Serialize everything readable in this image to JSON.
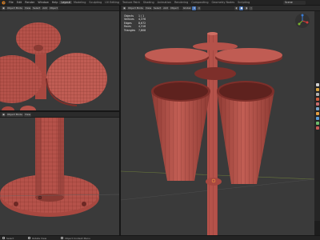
{
  "topbar": {
    "menus": [
      "File",
      "Edit",
      "Render",
      "Window",
      "Help"
    ],
    "workspaces": [
      "Layout",
      "Modeling",
      "Sculpting",
      "UV Editing",
      "Texture Paint",
      "Shading",
      "Animation",
      "Rendering",
      "Compositing",
      "Geometry Nodes",
      "Scripting"
    ],
    "active_workspace": "Layout",
    "scene": "Scene"
  },
  "viewports": {
    "top_left": {
      "mode": "Object Mode",
      "view": "View",
      "select": "Select",
      "add": "Add",
      "object": "Object"
    },
    "bottom_left": {
      "mode": "Object Mode",
      "view": "View"
    },
    "main": {
      "mode": "Object Mode",
      "view": "View",
      "select": "Select",
      "add": "Add",
      "object": "Object",
      "shading": "Global"
    }
  },
  "stats": [
    {
      "label": "Objects",
      "value": "1 / 1"
    },
    {
      "label": "Vertices",
      "value": "4,376"
    },
    {
      "label": "Edges",
      "value": "8,672"
    },
    {
      "label": "Faces",
      "value": "4,316"
    },
    {
      "label": "Triangles",
      "value": "7,808"
    }
  ],
  "statusbar": {
    "left": "Select",
    "middle": "Rotate View",
    "right": "Object Context Menu"
  },
  "colors": {
    "mesh": "#b5524a",
    "mesh_dark": "#7d2f2a",
    "mesh_light": "#cf6e63",
    "viewport_bg": "#3a3a3a",
    "accent": "#4772b3"
  },
  "icons": [
    "blender-logo-icon",
    "view-gizmo-icon",
    "zoom-icon",
    "pan-icon",
    "camera-icon",
    "grid-icon",
    "move-icon",
    "rotate-icon",
    "scale-icon"
  ]
}
